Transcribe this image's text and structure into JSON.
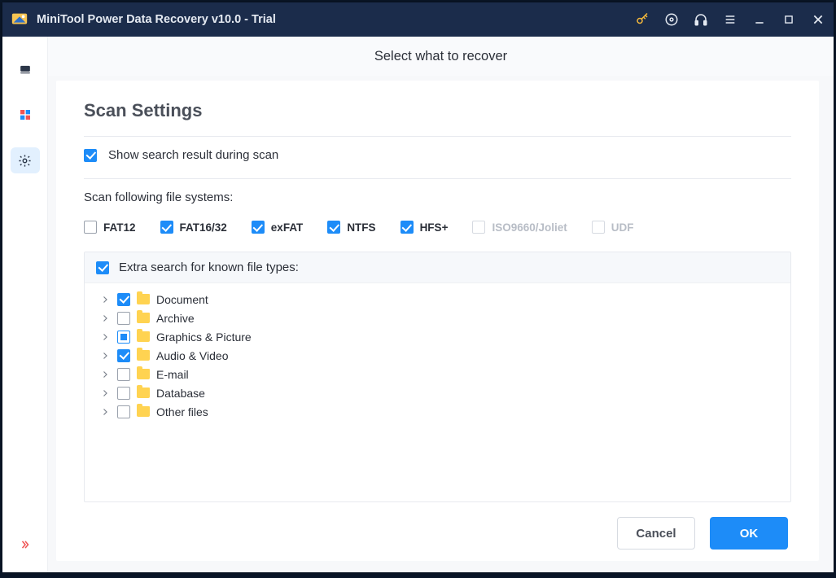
{
  "titlebar": {
    "app_title": "MiniTool Power Data Recovery v10.0 - Trial"
  },
  "header": {
    "tab_label": "Select what to recover"
  },
  "settings": {
    "title": "Scan Settings",
    "show_results_label": "Show search result during scan",
    "show_results_checked": true,
    "fs_heading": "Scan following file systems:",
    "filesystems": [
      {
        "label": "FAT12",
        "checked": false,
        "disabled": false
      },
      {
        "label": "FAT16/32",
        "checked": true,
        "disabled": false
      },
      {
        "label": "exFAT",
        "checked": true,
        "disabled": false
      },
      {
        "label": "NTFS",
        "checked": true,
        "disabled": false
      },
      {
        "label": "HFS+",
        "checked": true,
        "disabled": false
      },
      {
        "label": "ISO9660/Joliet",
        "checked": false,
        "disabled": true
      },
      {
        "label": "UDF",
        "checked": false,
        "disabled": true
      }
    ],
    "extra_search_label": "Extra search for known file types:",
    "extra_search_checked": true,
    "file_types": [
      {
        "label": "Document",
        "state": "checked"
      },
      {
        "label": "Archive",
        "state": "unchecked"
      },
      {
        "label": "Graphics & Picture",
        "state": "indeterminate"
      },
      {
        "label": "Audio & Video",
        "state": "checked"
      },
      {
        "label": "E-mail",
        "state": "unchecked"
      },
      {
        "label": "Database",
        "state": "unchecked"
      },
      {
        "label": "Other files",
        "state": "unchecked"
      }
    ]
  },
  "buttons": {
    "cancel": "Cancel",
    "ok": "OK"
  }
}
